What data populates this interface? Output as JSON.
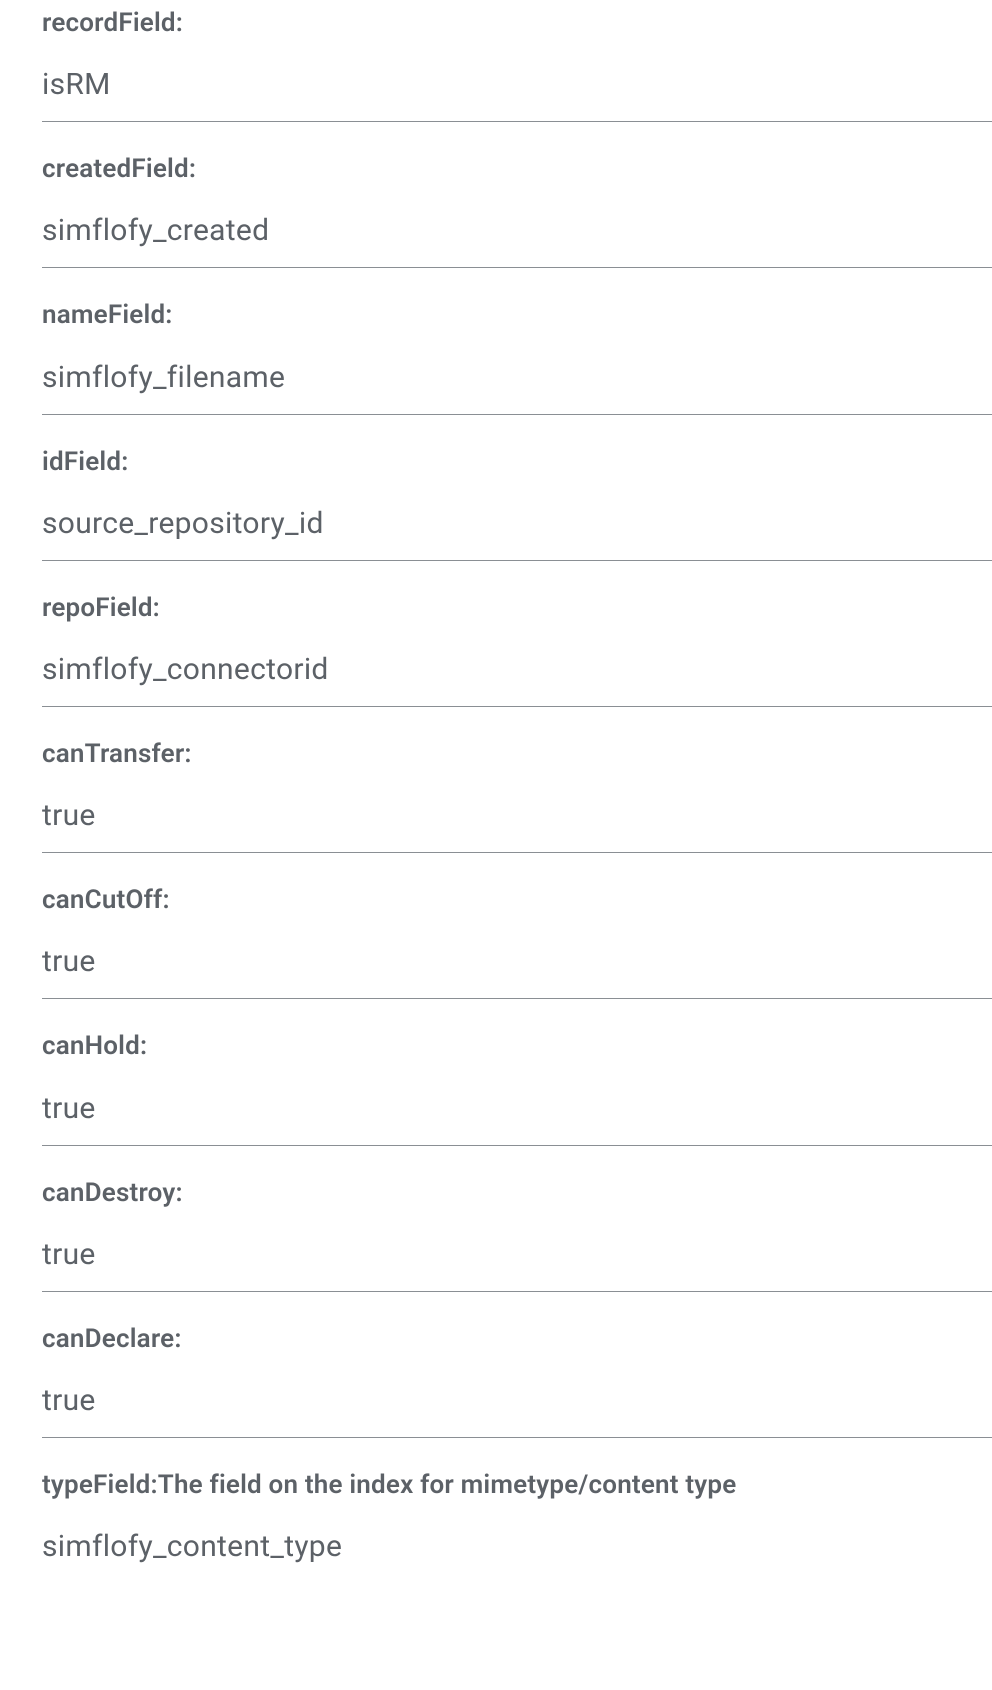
{
  "fields": [
    {
      "label": "recordField:",
      "value": "isRM"
    },
    {
      "label": "createdField:",
      "value": "simflofy_created"
    },
    {
      "label": "nameField:",
      "value": "simflofy_filename"
    },
    {
      "label": "idField:",
      "value": "source_repository_id"
    },
    {
      "label": "repoField:",
      "value": "simflofy_connectorid"
    },
    {
      "label": "canTransfer:",
      "value": "true"
    },
    {
      "label": "canCutOff:",
      "value": "true"
    },
    {
      "label": "canHold:",
      "value": "true"
    },
    {
      "label": "canDestroy:",
      "value": "true"
    },
    {
      "label": "canDeclare:",
      "value": "true"
    },
    {
      "label": "typeField:The field on the index for mimetype/content type",
      "value": "simflofy_content_type"
    }
  ]
}
